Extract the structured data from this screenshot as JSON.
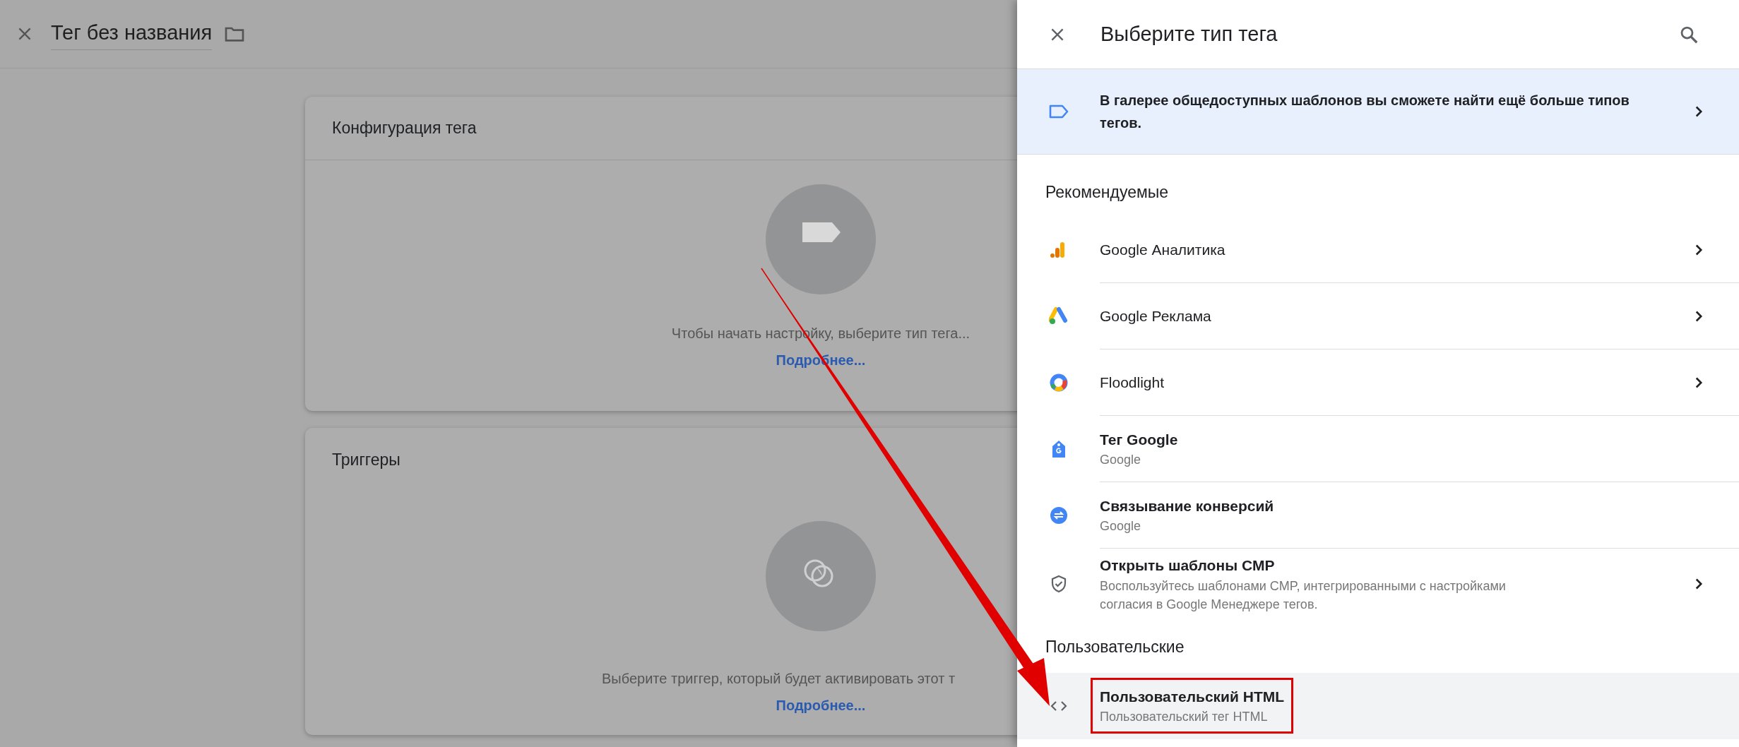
{
  "editor": {
    "tag_name": "Тег без названия"
  },
  "cards": [
    {
      "kind": "tag",
      "title": "Конфигурация тега",
      "hint": "Чтобы начать настройку, выберите тип тега...",
      "link": "Подробнее..."
    },
    {
      "kind": "trigger",
      "title": "Триггеры",
      "hint": "Выберите триггер, который будет активировать этот т",
      "link": "Подробнее..."
    }
  ],
  "panel": {
    "title": "Выберите тип тега",
    "banner": "В галерее общедоступных шаблонов вы сможете найти ещё больше типов тегов.",
    "sections": [
      {
        "heading": "Рекомендуемые",
        "items": [
          {
            "kind": "analytics",
            "title": "Google Аналитика",
            "has_submenu": true,
            "hovered": false,
            "annotated": false
          },
          {
            "kind": "ads",
            "title": "Google Реклама",
            "has_submenu": true,
            "hovered": false,
            "annotated": false
          },
          {
            "kind": "floodlight",
            "title": "Floodlight",
            "has_submenu": true,
            "hovered": false,
            "annotated": false
          },
          {
            "kind": "google-tag",
            "title": "Тег Google",
            "subtitle": "Google",
            "has_submenu": false,
            "hovered": false,
            "annotated": false
          },
          {
            "kind": "conversion-linker",
            "title": "Связывание конверсий",
            "subtitle": "Google",
            "has_submenu": false,
            "hovered": false,
            "annotated": false
          },
          {
            "kind": "cmp",
            "title": "Открыть шаблоны CMP",
            "subtitle": "Воспользуйтесь шаблонами CMP, интегрированными с настройками согласия в Google Менеджере тегов.",
            "has_submenu": true,
            "hovered": false,
            "annotated": false
          }
        ]
      },
      {
        "heading": "Пользовательские",
        "items": [
          {
            "kind": "custom-html",
            "title": "Пользовательский HTML",
            "subtitle": "Пользовательский тег HTML",
            "has_submenu": false,
            "hovered": true,
            "annotated": true
          }
        ]
      }
    ]
  }
}
